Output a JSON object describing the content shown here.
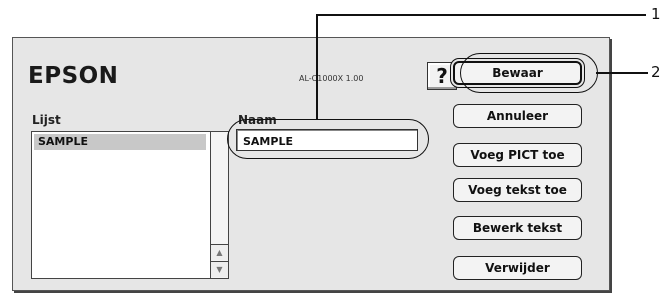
{
  "dialog": {
    "brand": "EPSON",
    "model": "AL-C1000X 1.00",
    "help_label": "?"
  },
  "list": {
    "label": "Lijst",
    "items": [
      "SAMPLE"
    ],
    "scroll_up": "▲",
    "scroll_down": "▼"
  },
  "name": {
    "label": "Naam",
    "value": "SAMPLE"
  },
  "buttons": {
    "save": "Bewaar",
    "cancel": "Annuleer",
    "add_pict": "Voeg PICT toe",
    "add_text": "Voeg tekst toe",
    "edit_text": "Bewerk tekst",
    "delete": "Verwijder"
  },
  "callouts": {
    "one": "1",
    "two": "2"
  }
}
